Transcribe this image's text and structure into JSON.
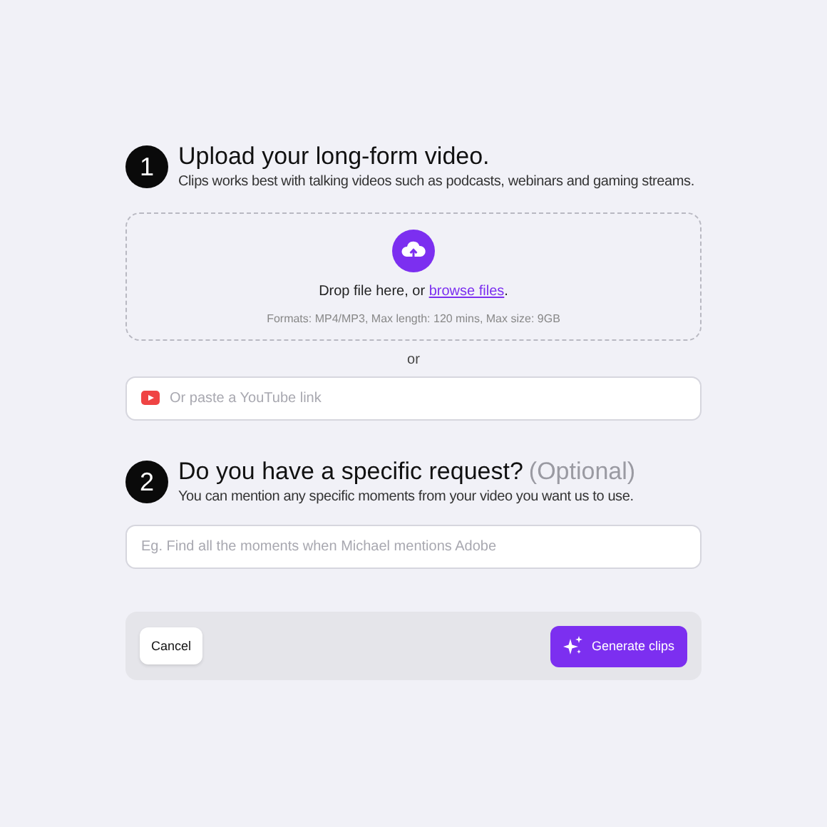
{
  "steps": [
    {
      "number": "1",
      "title": "Upload your long-form video.",
      "subtitle": "Clips works best with talking videos such as podcasts, webinars and gaming streams."
    },
    {
      "number": "2",
      "title": "Do you have a specific request?",
      "optional": "(Optional)",
      "subtitle": "You can mention any specific moments from your video you want us to use."
    }
  ],
  "dropzone": {
    "before": "Drop file here, or ",
    "link": "browse files",
    "after": ".",
    "formats": "Formats: MP4/MP3, Max length: 120 mins, Max size: 9GB"
  },
  "separator": "or",
  "youtube_field": {
    "placeholder": "Or paste a YouTube link"
  },
  "request_field": {
    "placeholder": "Eg. Find all the moments when Michael mentions Adobe"
  },
  "buttons": [
    {
      "label": "Cancel",
      "kind": "secondary"
    },
    {
      "label": "Generate clips",
      "kind": "primary"
    }
  ]
}
